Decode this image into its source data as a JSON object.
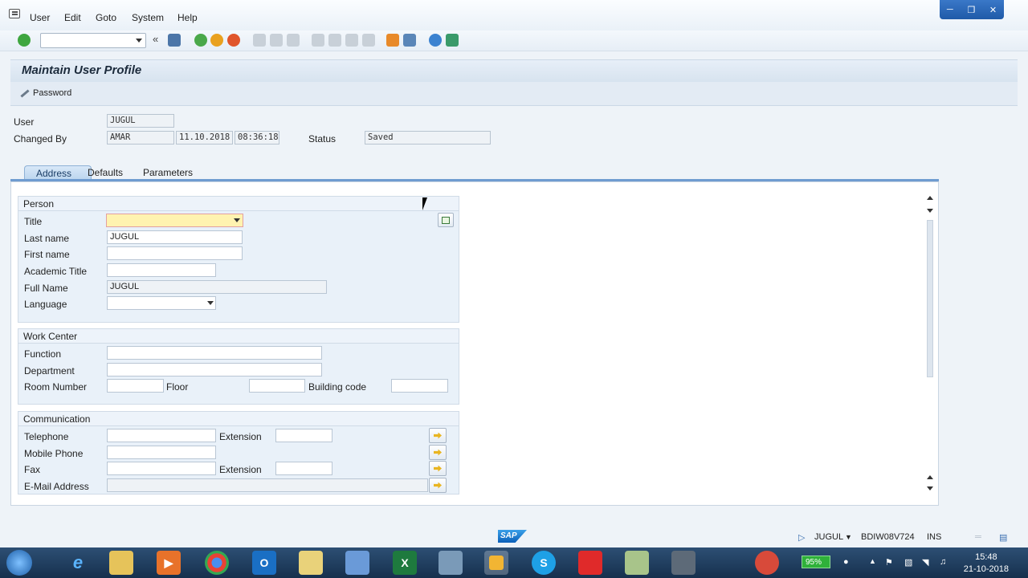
{
  "menubar": {
    "items": [
      "User",
      "Edit",
      "Goto",
      "System",
      "Help"
    ]
  },
  "page_title": "Maintain User Profile",
  "app_toolbar": {
    "password_label": "Password"
  },
  "header": {
    "user_label": "User",
    "user_value": "JUGUL",
    "changed_by_label": "Changed By",
    "changed_by_value": "AMAR",
    "date_value": "11.10.2018",
    "time_value": "08:36:18",
    "status_label": "Status",
    "status_value": "Saved"
  },
  "tabs": [
    "Address",
    "Defaults",
    "Parameters"
  ],
  "person": {
    "title": "Person",
    "title_label": "Title",
    "title_value": "",
    "last_name_label": "Last name",
    "last_name_value": "JUGUL",
    "first_name_label": "First name",
    "first_name_value": "",
    "academic_title_label": "Academic Title",
    "academic_title_value": "",
    "full_name_label": "Full Name",
    "full_name_value": "JUGUL",
    "language_label": "Language",
    "language_value": ""
  },
  "work_center": {
    "title": "Work Center",
    "function_label": "Function",
    "department_label": "Department",
    "room_label": "Room Number",
    "floor_label": "Floor",
    "building_label": "Building code"
  },
  "communication": {
    "title": "Communication",
    "telephone_label": "Telephone",
    "extension_label": "Extension",
    "mobile_label": "Mobile Phone",
    "fax_label": "Fax",
    "fax_extension_label": "Extension",
    "email_label": "E-Mail Address"
  },
  "statusbar": {
    "user": "JUGUL",
    "server": "BDIW08V724",
    "mode": "INS",
    "logo": "SAP"
  },
  "taskbar": {
    "battery": "95%",
    "time": "15:48",
    "date": "21-10-2018"
  },
  "colors": {
    "tab_accent": "#6f9cd0",
    "required_field": "#fff3b0",
    "battery": "#2fb13a"
  }
}
